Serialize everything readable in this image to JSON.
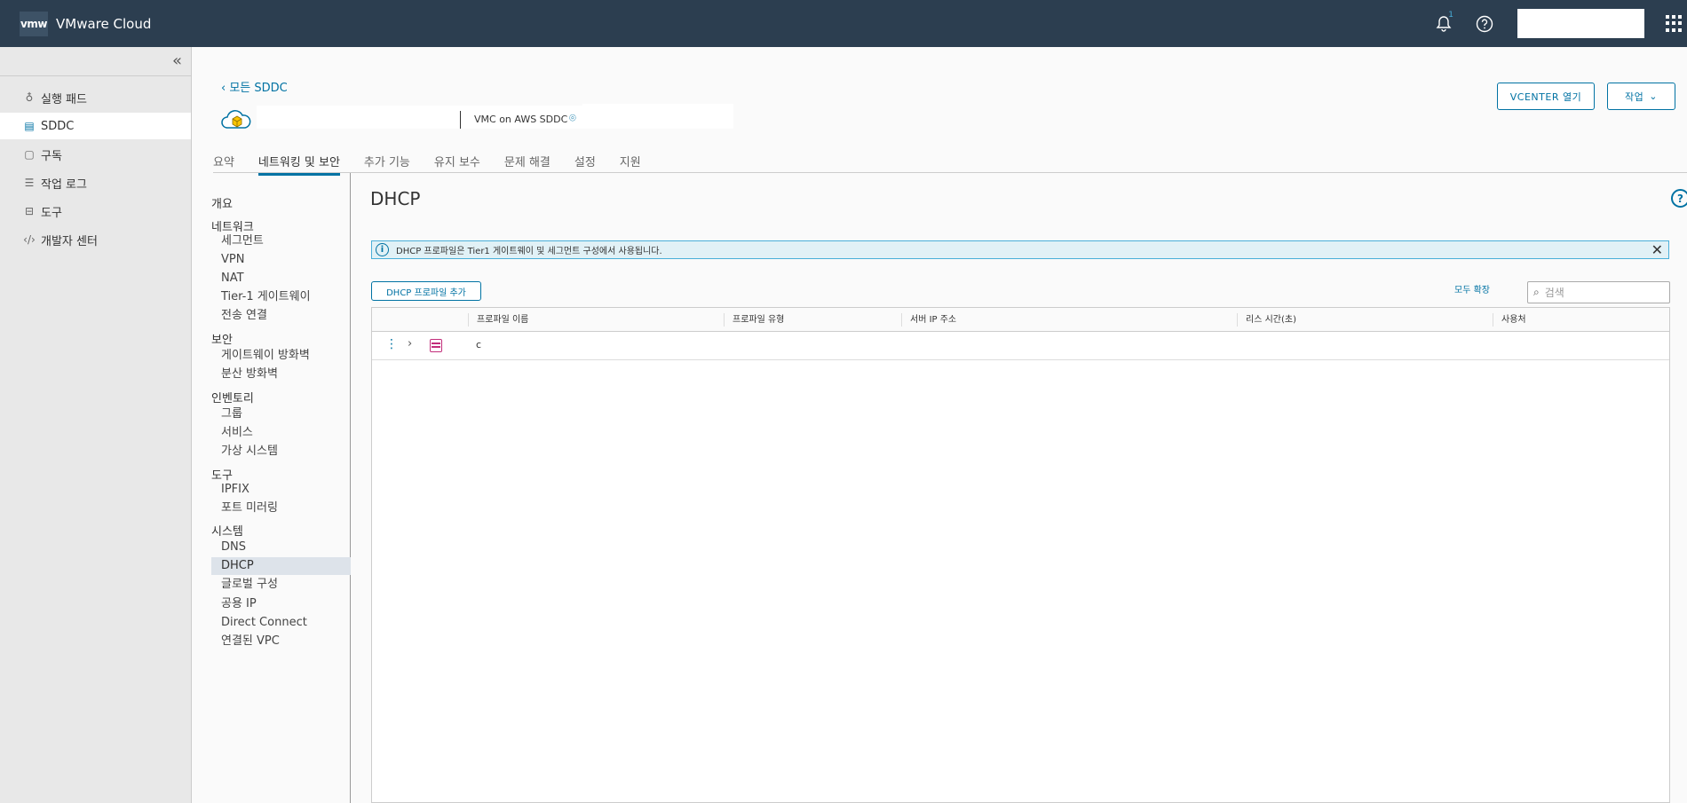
{
  "header": {
    "logo_text": "vmw",
    "app_title": "VMware Cloud",
    "notification_count": "1"
  },
  "sidebar": {
    "items": [
      {
        "label": "실행 패드",
        "icon": "rocket-icon"
      },
      {
        "label": "SDDC",
        "icon": "table-icon"
      },
      {
        "label": "구독",
        "icon": "calendar-icon"
      },
      {
        "label": "작업 로그",
        "icon": "list-icon"
      },
      {
        "label": "도구",
        "icon": "toolbox-icon"
      },
      {
        "label": "개발자 센터",
        "icon": "code-icon"
      }
    ],
    "active_index": 1
  },
  "sddc": {
    "back_link": "모든 SDDC",
    "type": "VMC on AWS SDDC",
    "vcenter_button": "VCENTER 열기",
    "action_button": "작업"
  },
  "tabs": [
    "요약",
    "네트워킹 및 보안",
    "추가 기능",
    "유지 보수",
    "문제 해결",
    "설정",
    "지원"
  ],
  "subnav": {
    "overview": "개요",
    "network": {
      "heading": "네트워크",
      "items": [
        "세그먼트",
        "VPN",
        "NAT",
        "Tier-1 게이트웨이",
        "전송 연결"
      ]
    },
    "security": {
      "heading": "보안",
      "items": [
        "게이트웨이 방화벽",
        "분산 방화벽"
      ]
    },
    "inventory": {
      "heading": "인벤토리",
      "items": [
        "그룹",
        "서비스",
        "가상 시스템"
      ]
    },
    "tools": {
      "heading": "도구",
      "items": [
        "IPFIX",
        "포트 미러링"
      ]
    },
    "system": {
      "heading": "시스템",
      "items": [
        "DNS",
        "DHCP",
        "글로벌 구성",
        "공용 IP",
        "Direct Connect",
        "연결된 VPC"
      ]
    }
  },
  "content": {
    "title": "DHCP",
    "alert": "DHCP 프로파일은 Tier1 게이트웨이 및 세그먼트 구성에서 사용됩니다.",
    "add_button": "DHCP 프로파일 추가",
    "expand_all": "모두 확장",
    "search_placeholder": "검색",
    "columns": [
      "프로파일 이름",
      "프로파일 유형",
      "서버 IP 주소",
      "리스 시간(초)",
      "사용처"
    ],
    "rows": [
      {
        "name": "c"
      }
    ]
  }
}
